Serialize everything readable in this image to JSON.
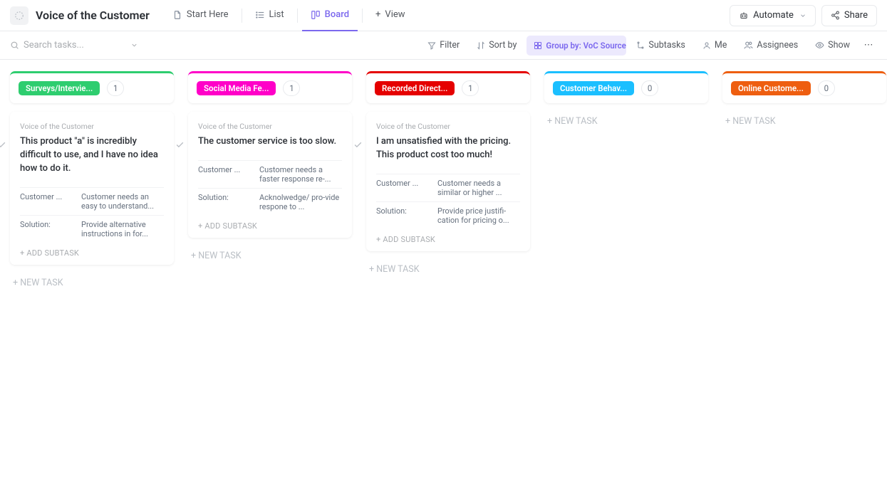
{
  "header": {
    "title": "Voice of the Customer",
    "tabs": {
      "start": "Start Here",
      "list": "List",
      "board": "Board",
      "view": "View"
    },
    "automate": "Automate",
    "share": "Share"
  },
  "toolbar": {
    "search_placeholder": "Search tasks...",
    "filter": "Filter",
    "sort": "Sort by",
    "group": "Group by: VoC Source",
    "subtasks": "Subtasks",
    "me": "Me",
    "assignees": "Assignees",
    "show": "Show"
  },
  "columns": [
    {
      "name": "Surveys/Intervie...",
      "bar": "#2ecd6f",
      "pill": "#2ecd6f",
      "count": "1",
      "cards": [
        {
          "breadcrumb": "Voice of the Customer",
          "title": "This product \"a\" is incredibly difficult to use, and I have no idea how to do it.",
          "fields": [
            {
              "label": "Customer ...",
              "value": "Customer needs an easy to understand..."
            },
            {
              "label": "Solution:",
              "value": "Provide alternative instructions in for..."
            }
          ]
        }
      ]
    },
    {
      "name": "Social Media Fe...",
      "bar": "#ff00c8",
      "pill": "#ff00c8",
      "count": "1",
      "cards": [
        {
          "breadcrumb": "Voice of the Customer",
          "title": "The customer service is too slow.",
          "fields": [
            {
              "label": "Customer ...",
              "value": "Customer needs a faster response re-..."
            },
            {
              "label": "Solution:",
              "value": "Acknolwedge/ pro-vide respone to ..."
            }
          ]
        }
      ]
    },
    {
      "name": "Recorded Direct...",
      "bar": "#e50000",
      "pill": "#e50000",
      "count": "1",
      "cards": [
        {
          "breadcrumb": "Voice of the Customer",
          "title": "I am unsatisfied with the pricing. This product cost too much!",
          "fields": [
            {
              "label": "Customer ...",
              "value": "Customer needs a similar or higher ..."
            },
            {
              "label": "Solution:",
              "value": "Provide price justifi-cation for pricing o..."
            }
          ]
        }
      ]
    },
    {
      "name": "Customer Behav...",
      "bar": "#1bbfff",
      "pill": "#1bbfff",
      "count": "0",
      "cards": []
    },
    {
      "name": "Online Custome...",
      "bar": "#ee5e10",
      "pill": "#ee5e10",
      "count": "0",
      "cards": []
    }
  ],
  "partial": {
    "name": "Di"
  },
  "labels": {
    "add_subtask": "+ ADD SUBTASK",
    "new_task": "+ NEW TASK",
    "new_task_short": "+ N"
  }
}
